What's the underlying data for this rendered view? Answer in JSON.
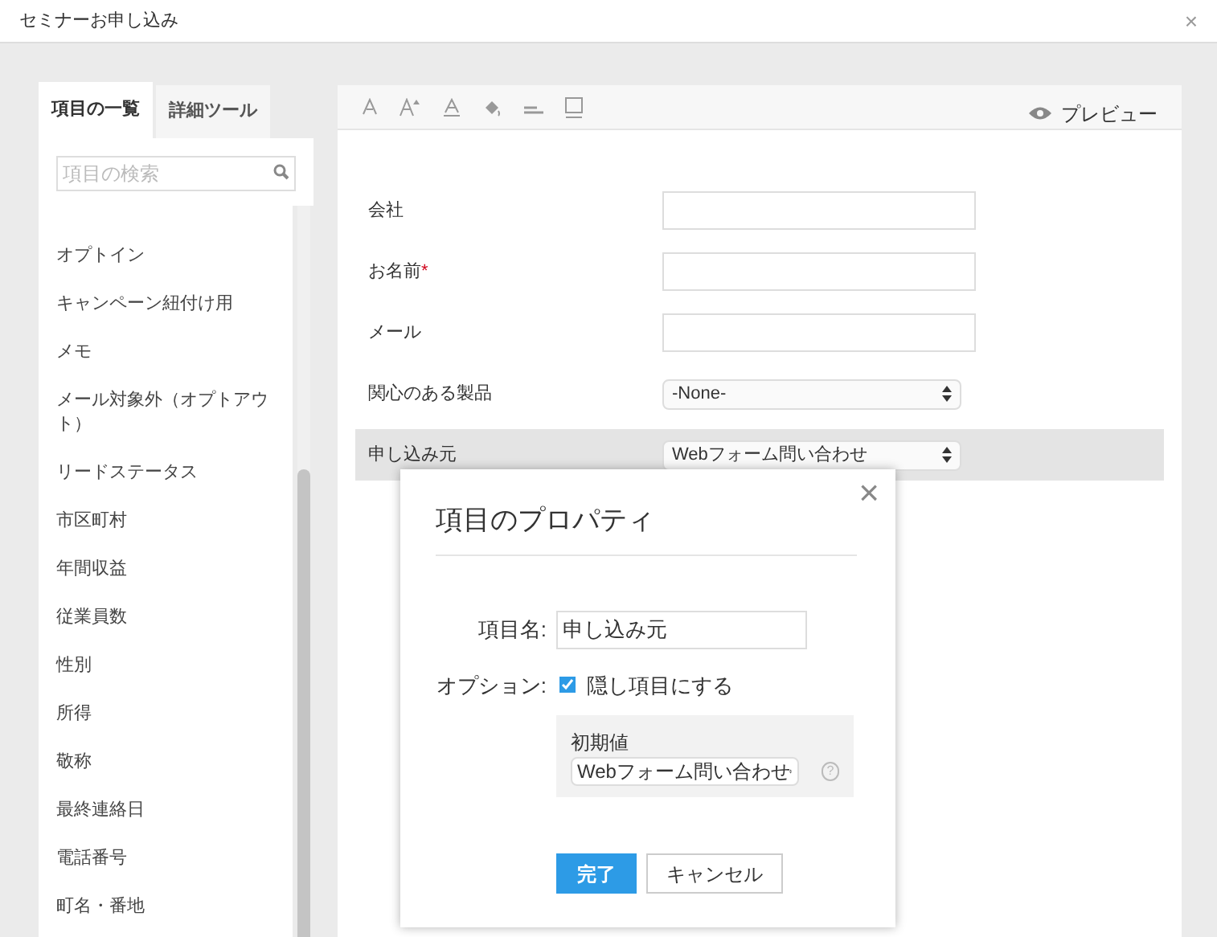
{
  "window": {
    "title": "セミナーお申し込み",
    "close": "×"
  },
  "sidebar": {
    "tabs": [
      {
        "label": "項目の一覧",
        "selected": true
      },
      {
        "label": "詳細ツール",
        "selected": false
      }
    ],
    "search": {
      "placeholder": "項目の検索"
    },
    "items": [
      "オプトイン",
      "キャンペーン紐付け用",
      "メモ",
      "メール対象外（オプトアウト）",
      "リードステータス",
      "市区町村",
      "年間収益",
      "従業員数",
      "性別",
      "所得",
      "敬称",
      "最終連絡日",
      "電話番号",
      "町名・番地"
    ]
  },
  "toolbar": {
    "preview": "プレビュー"
  },
  "form": {
    "rows": [
      {
        "label": "会社",
        "kind": "text",
        "selected": false
      },
      {
        "label": "お名前",
        "marker": "*",
        "kind": "text",
        "selected": false
      },
      {
        "label": "メール",
        "kind": "text",
        "selected": false
      },
      {
        "label": "関心のある製品",
        "kind": "select",
        "value": "-None-",
        "selected": false
      },
      {
        "label": "申し込み元",
        "kind": "select",
        "value": "Webフォーム問い合わせ",
        "selected": true
      }
    ]
  },
  "dialog": {
    "title": "項目のプロパティ",
    "close": "×",
    "name_label": "項目名:",
    "name_value": "申し込み元",
    "option_label": "オプション:",
    "hidden_option": {
      "label": "隠し項目にする",
      "checked": true
    },
    "default_label": "初期値",
    "default_value": "Webフォーム問い合わせ",
    "help": "?",
    "buttons": [
      {
        "label": "完了",
        "kind": "primary"
      },
      {
        "label": "キャンセル",
        "kind": "secondary"
      }
    ]
  }
}
